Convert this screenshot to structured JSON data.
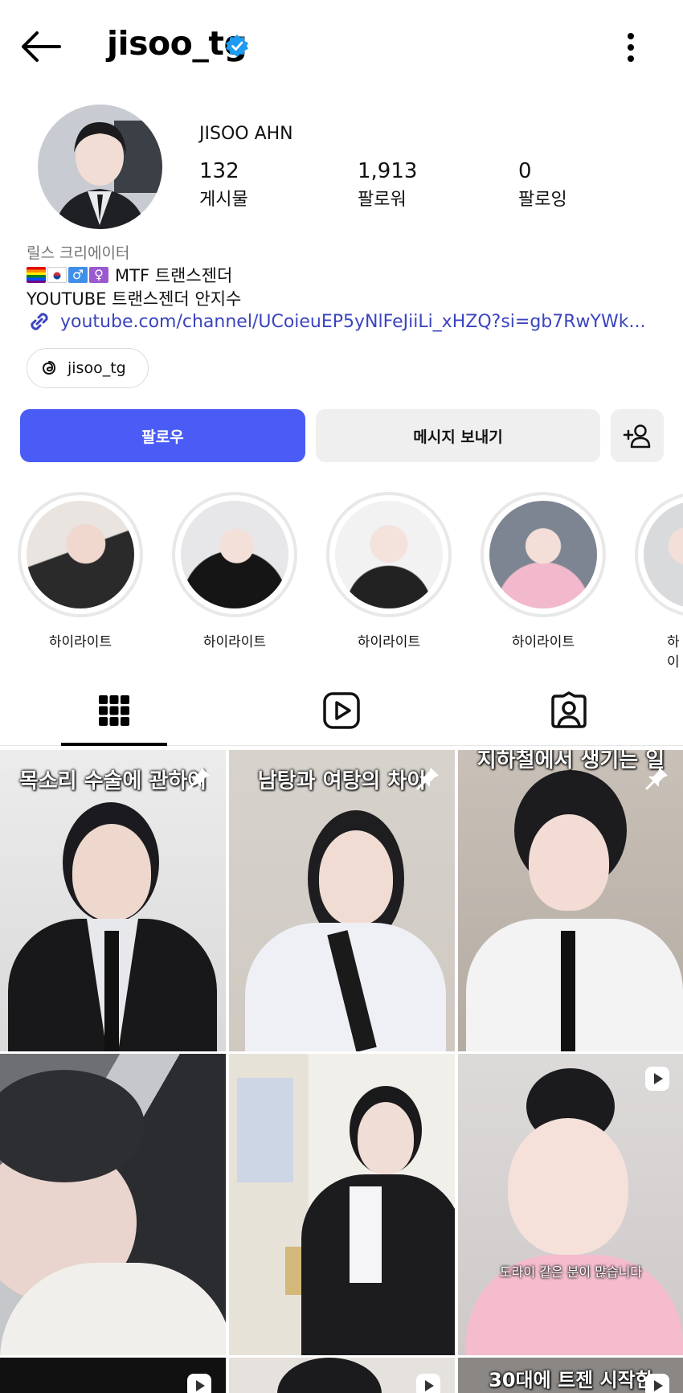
{
  "header": {
    "username": "jisoo_tg",
    "verified": true
  },
  "profile": {
    "full_name": "JISOO AHN",
    "stats": [
      {
        "value": "132",
        "label": "게시물"
      },
      {
        "value": "1,913",
        "label": "팔로워"
      },
      {
        "value": "0",
        "label": "팔로잉"
      }
    ],
    "category": "릴스 크리에이터",
    "bio_line1": "MTF 트랜스젠더",
    "bio_line2": "YOUTUBE 트랜스젠더 안지수",
    "link": "youtube.com/channel/UCoieuEP5yNlFeJiiLi_xHZQ?si=gb7RwYWk...",
    "threads_handle": "jisoo_tg"
  },
  "actions": {
    "follow_label": "팔로우",
    "message_label": "메시지 보내기"
  },
  "highlights": [
    {
      "label": "하이라이트"
    },
    {
      "label": "하이라이트"
    },
    {
      "label": "하이라이트"
    },
    {
      "label": "하이라이트"
    },
    {
      "label": "하이"
    }
  ],
  "grid": [
    {
      "caption": "목소리 수술에 관하여",
      "pinned": true
    },
    {
      "caption": "남탕과 여탕의 차이",
      "pinned": true
    },
    {
      "caption": "지하철에서 생기는 일",
      "pinned": true
    },
    {
      "caption": "",
      "pinned": false
    },
    {
      "caption": "",
      "pinned": false
    },
    {
      "caption": "",
      "pinned": false,
      "reel": true,
      "subtitle": "도라이 같은 분이 많습니다"
    },
    {
      "caption": "",
      "reel": true
    },
    {
      "caption": "",
      "reel": true
    },
    {
      "caption": "30대에 트젠 시작한",
      "reel": true
    }
  ],
  "colors": {
    "accent": "#4a5cf5",
    "link": "#3b44bf",
    "verified": "#1d9bf0"
  }
}
